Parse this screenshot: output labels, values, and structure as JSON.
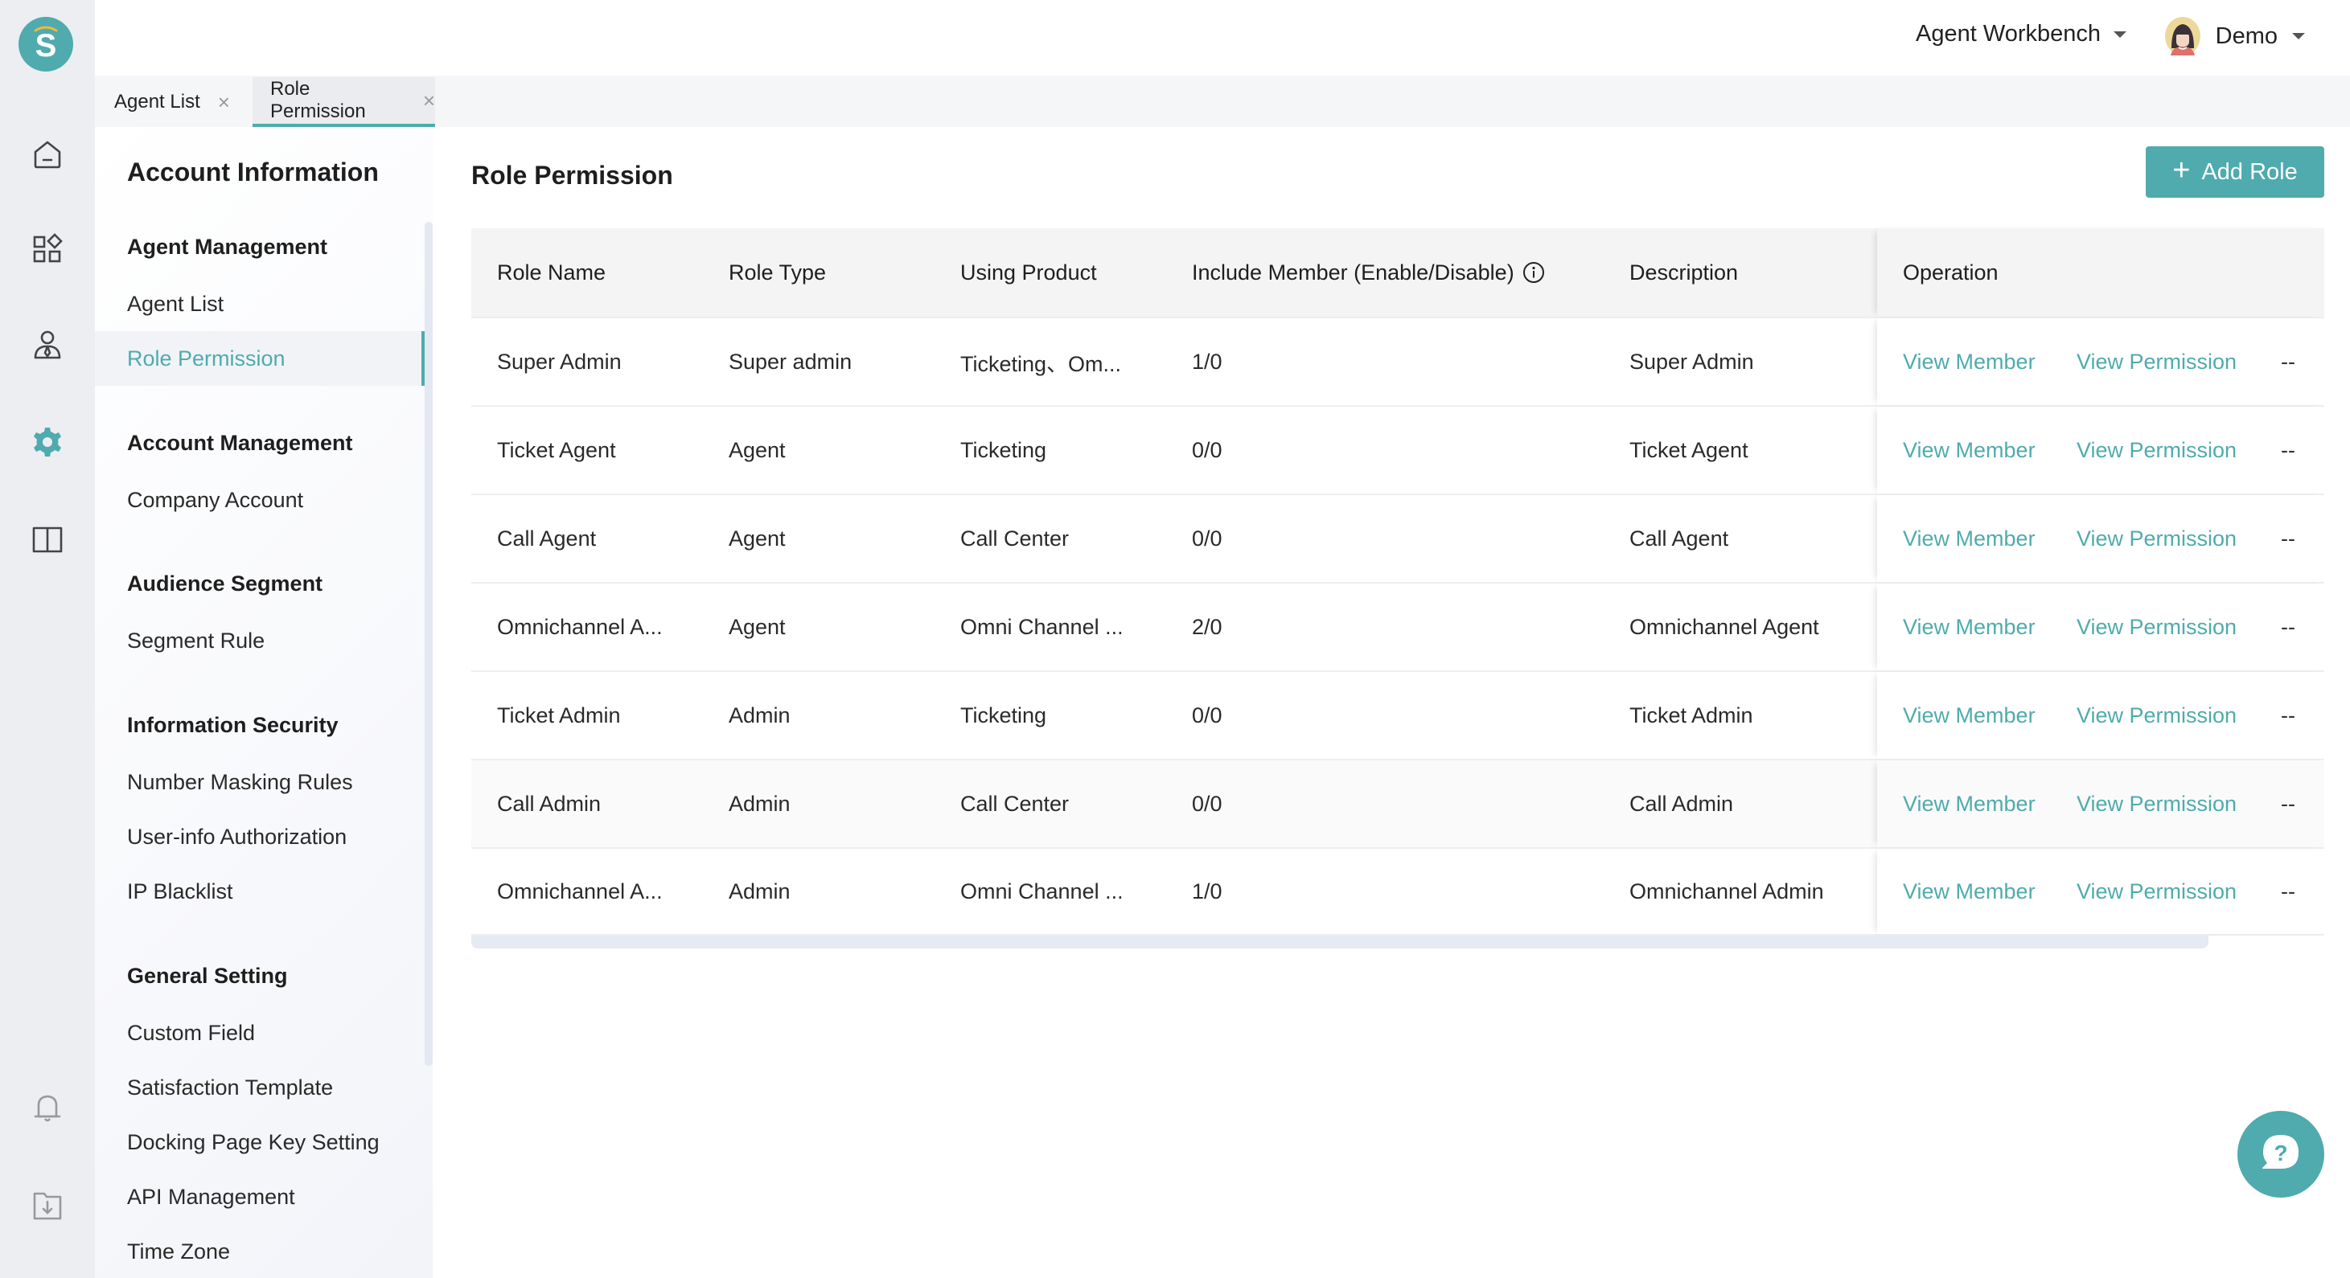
{
  "header": {
    "workbench_label": "Agent Workbench",
    "user_name": "Demo"
  },
  "tabs": [
    {
      "label": "Agent List",
      "active": false
    },
    {
      "label": "Role Permission",
      "active": true
    }
  ],
  "rail": {
    "items": [
      {
        "icon": "home-icon",
        "active": false
      },
      {
        "icon": "apps-icon",
        "active": false
      },
      {
        "icon": "agent-icon",
        "active": false
      },
      {
        "icon": "gear-icon",
        "active": true
      },
      {
        "icon": "book-icon",
        "active": false
      }
    ],
    "bottom": [
      {
        "icon": "bell-icon"
      },
      {
        "icon": "download-folder-icon"
      }
    ],
    "accent": "#4fabad"
  },
  "sidebar": {
    "title": "Account Information",
    "groups": [
      {
        "title": "Agent Management",
        "items": [
          "Agent List",
          "Role Permission"
        ]
      },
      {
        "title": "Account Management",
        "items": [
          "Company Account"
        ]
      },
      {
        "title": "Audience Segment",
        "items": [
          "Segment Rule"
        ]
      },
      {
        "title": "Information Security",
        "items": [
          "Number Masking Rules",
          "User-info Authorization",
          "IP Blacklist"
        ]
      },
      {
        "title": "General Setting",
        "items": [
          "Custom Field",
          "Satisfaction Template",
          "Docking Page Key Setting",
          "API Management",
          "Time Zone"
        ]
      }
    ],
    "active_item": "Role Permission"
  },
  "main": {
    "title": "Role Permission",
    "add_button_label": "Add Role",
    "table": {
      "columns": [
        "Role Name",
        "Role Type",
        "Using Product",
        "Include Member (Enable/Disable)",
        "Description",
        "Operation"
      ],
      "rows": [
        {
          "name": "Super Admin",
          "type": "Super admin",
          "product": "Ticketing、Om...",
          "members": "1/0",
          "description": "Super Admin"
        },
        {
          "name": "Ticket Agent",
          "type": "Agent",
          "product": "Ticketing",
          "members": "0/0",
          "description": "Ticket Agent"
        },
        {
          "name": "Call Agent",
          "type": "Agent",
          "product": "Call Center",
          "members": "0/0",
          "description": "Call Agent"
        },
        {
          "name": "Omnichannel A...",
          "type": "Agent",
          "product": "Omni Channel ...",
          "members": "2/0",
          "description": "Omnichannel Agent"
        },
        {
          "name": "Ticket Admin",
          "type": "Admin",
          "product": "Ticketing",
          "members": "0/0",
          "description": "Ticket Admin"
        },
        {
          "name": "Call Admin",
          "type": "Admin",
          "product": "Call Center",
          "members": "0/0",
          "description": "Call Admin"
        },
        {
          "name": "Omnichannel A...",
          "type": "Admin",
          "product": "Omni Channel ...",
          "members": "1/0",
          "description": "Omnichannel Admin"
        }
      ],
      "operations": {
        "view_member": "View Member",
        "view_permission": "View Permission",
        "more": "--"
      }
    }
  }
}
